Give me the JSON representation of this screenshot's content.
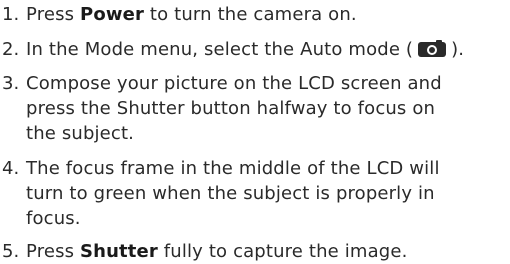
{
  "steps": [
    {
      "number": "1.",
      "pre": "Press ",
      "bold": "Power",
      "post": " to turn the camera on."
    },
    {
      "number": "2.",
      "pre": "In the Mode menu, select the Auto mode (",
      "icon": "camera-icon",
      "post": ")."
    },
    {
      "number": "3.",
      "lines": [
        "Compose your picture on the LCD screen and",
        "press the Shutter button halfway to focus on",
        "the subject."
      ]
    },
    {
      "number": "4.",
      "lines": [
        "The focus frame in the middle of the LCD will",
        "turn to green when the subject is properly in",
        "focus."
      ]
    },
    {
      "number": "5.",
      "pre": "Press ",
      "bold": "Shutter",
      "post": " fully to capture the image."
    }
  ]
}
